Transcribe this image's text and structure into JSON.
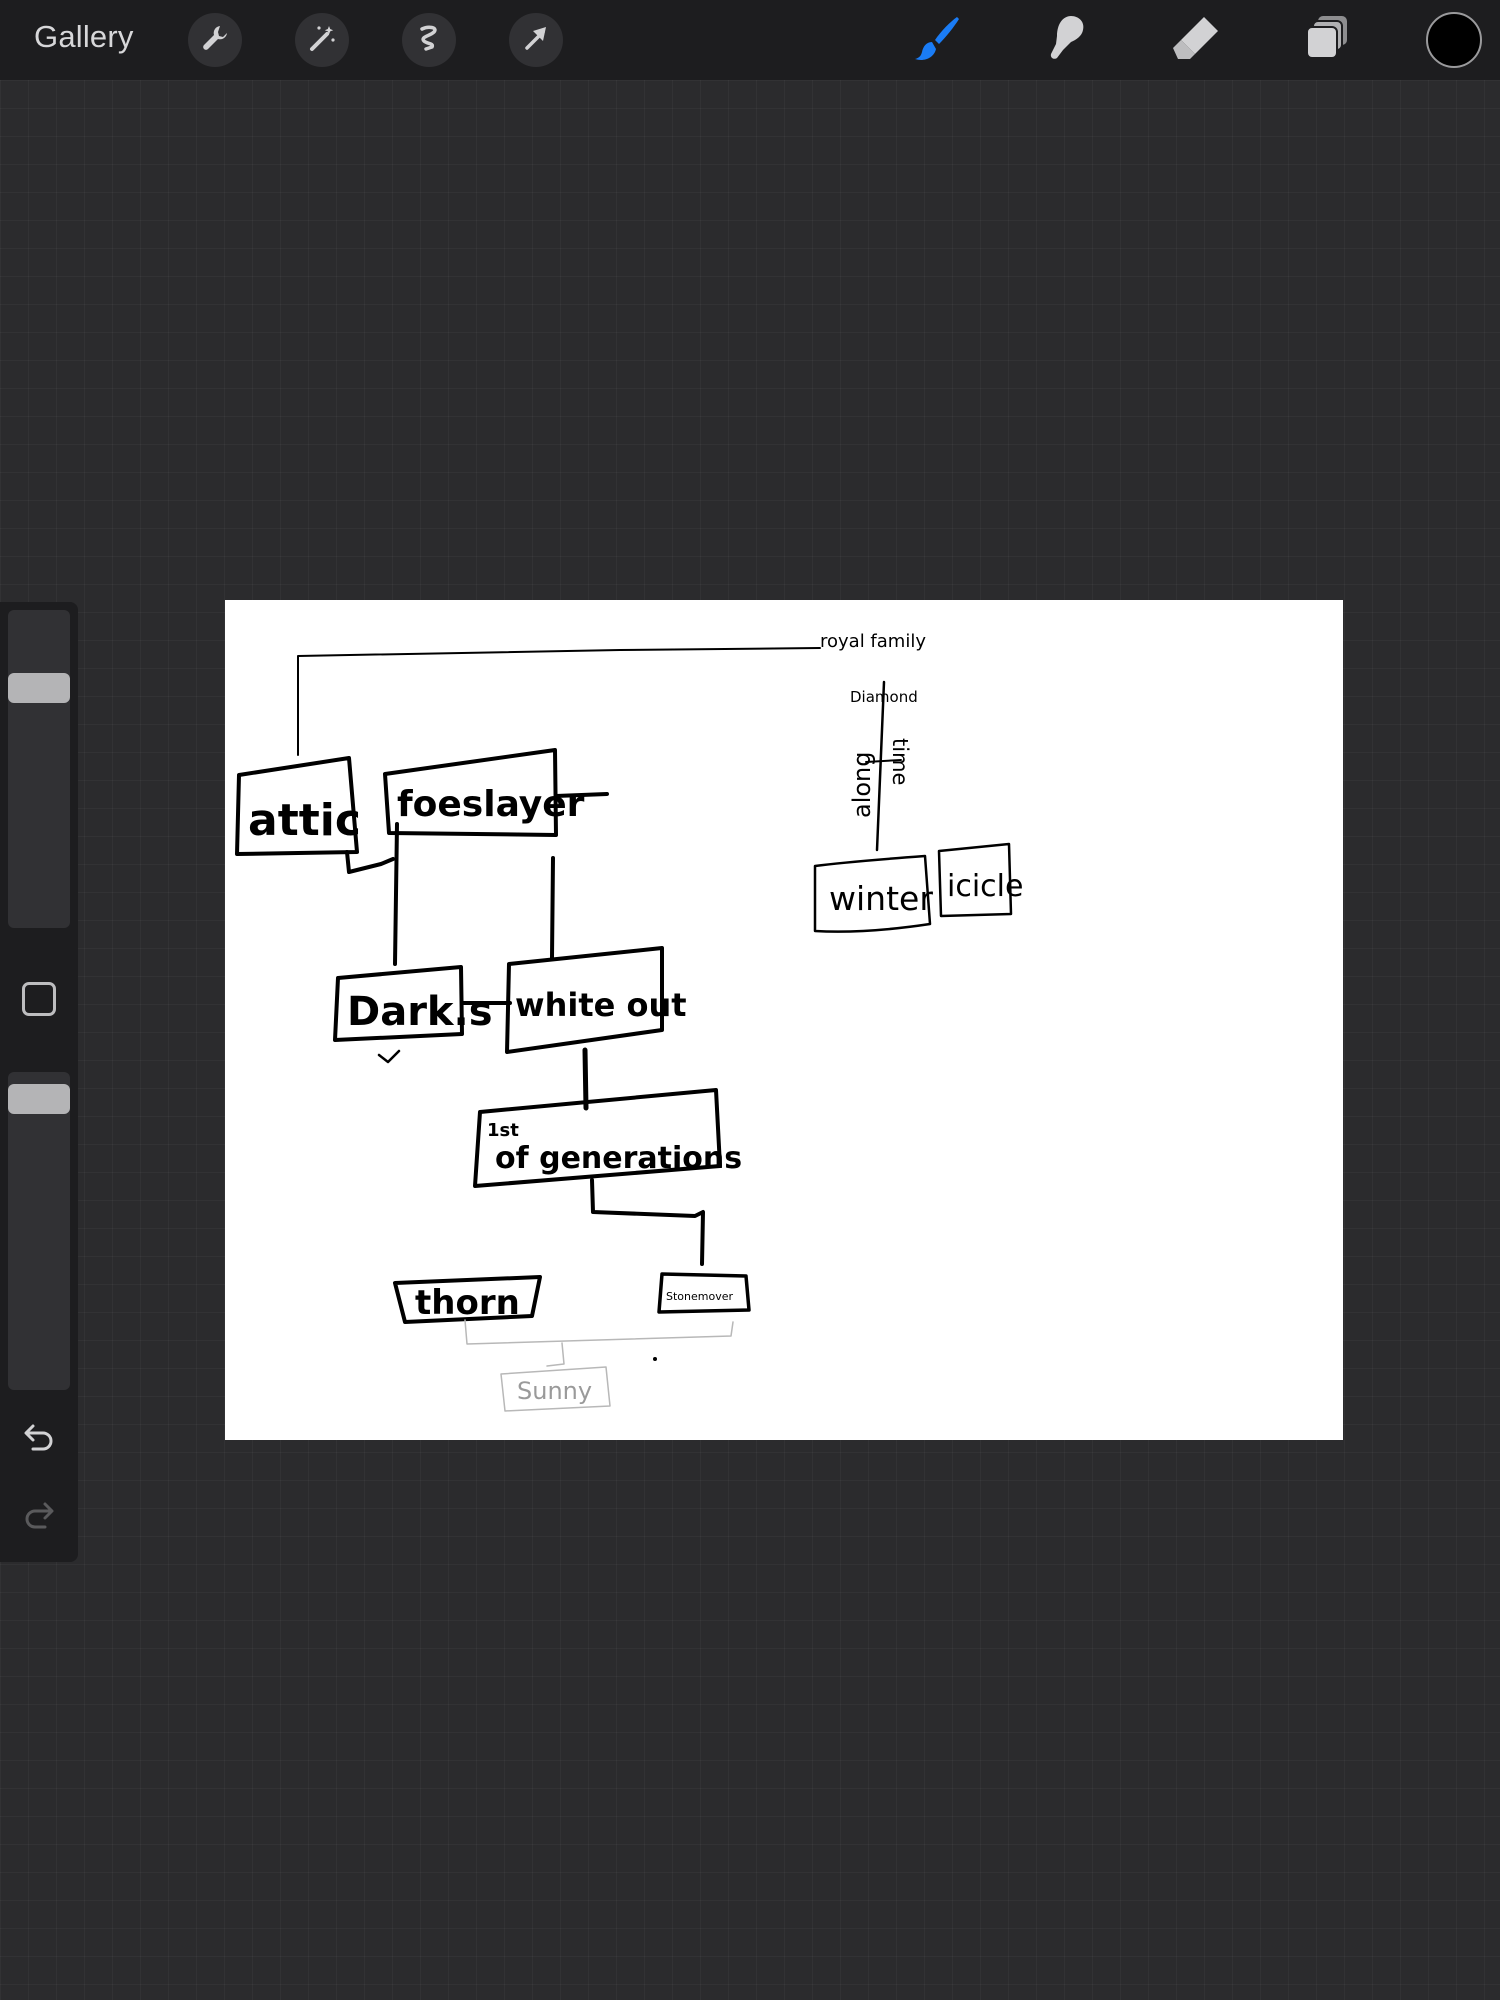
{
  "toolbar": {
    "gallery_label": "Gallery",
    "left_tools": [
      "wrench-icon",
      "magic-wand-icon",
      "selection-icon",
      "transform-arrow-icon"
    ],
    "right_tools": [
      "brush-icon",
      "smudge-icon",
      "eraser-icon",
      "layers-icon"
    ],
    "active_tool": "brush",
    "accent_color": "#1a7cf5",
    "current_color": "#000000"
  },
  "sidebar": {
    "brush_size_level": 0.78,
    "opacity_level": 0.96,
    "undo_icon": "undo-icon",
    "redo_icon": "redo-icon"
  },
  "drawing": {
    "labels": {
      "royal_family": "royal family",
      "diamond": "Diamond",
      "along": "along",
      "time": "time",
      "winter": "winter",
      "icicle": "icicle",
      "attic": "attic",
      "foeslayer": "foeslayer",
      "darks": "Dark.s",
      "whiteout": "white out",
      "first_gen_line1": "1st",
      "first_gen_line2": "of generations",
      "thorn": "thorn",
      "stonemover": "Stonemover",
      "sunny": "Sunny"
    }
  }
}
